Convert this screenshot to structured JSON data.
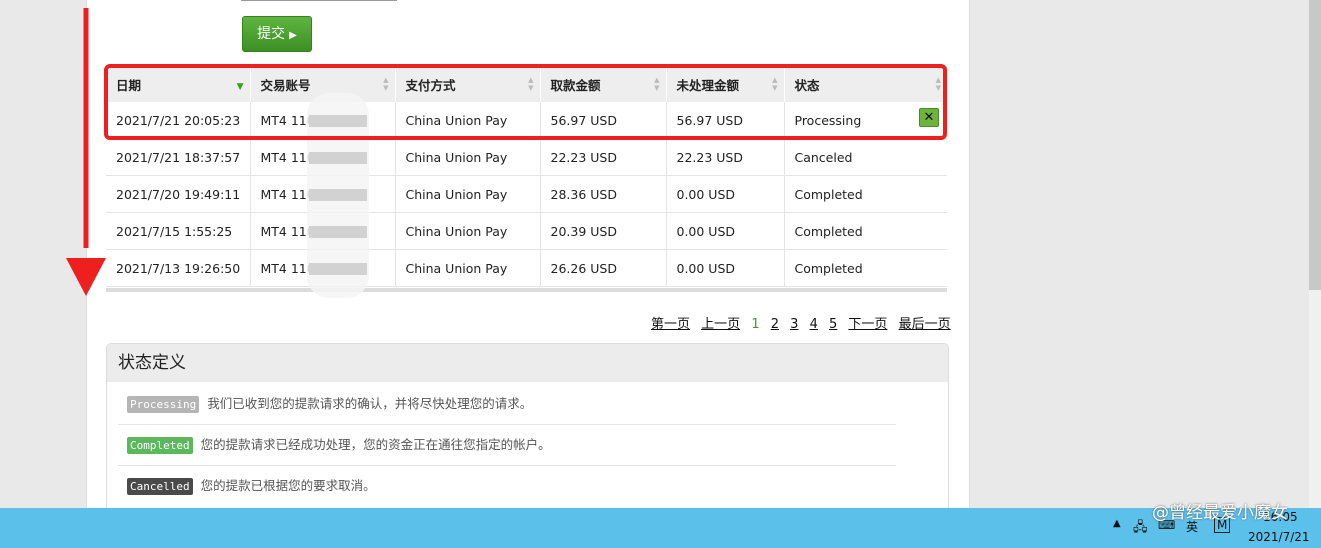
{
  "form": {
    "submit_label": "提交"
  },
  "table": {
    "headers": [
      "日期",
      "交易账号",
      "支付方式",
      "取款金额",
      "未处理金额",
      "状态"
    ],
    "rows": [
      {
        "date": "2021/7/21 20:05:23",
        "account": "MT4 110",
        "method": "China Union Pay",
        "amount": "56.97 USD",
        "pending": "56.97 USD",
        "status": "Processing"
      },
      {
        "date": "2021/7/21 18:37:57",
        "account": "MT4 110",
        "method": "China Union Pay",
        "amount": "22.23 USD",
        "pending": "22.23 USD",
        "status": "Canceled"
      },
      {
        "date": "2021/7/20 19:49:11",
        "account": "MT4 110",
        "method": "China Union Pay",
        "amount": "28.36 USD",
        "pending": "0.00 USD",
        "status": "Completed"
      },
      {
        "date": "2021/7/15 1:55:25",
        "account": "MT4 110",
        "method": "China Union Pay",
        "amount": "20.39 USD",
        "pending": "0.00 USD",
        "status": "Completed"
      },
      {
        "date": "2021/7/13 19:26:50",
        "account": "MT4 110",
        "method": "China Union Pay",
        "amount": "26.26 USD",
        "pending": "0.00 USD",
        "status": "Completed"
      }
    ]
  },
  "pagination": {
    "first": "第一页",
    "prev": "上一页",
    "pages": [
      "1",
      "2",
      "3",
      "4",
      "5"
    ],
    "next": "下一页",
    "last": "最后一页"
  },
  "status_defs": {
    "title": "状态定义",
    "items": [
      {
        "badge": "Processing",
        "color": "#b5b5b5",
        "text": "我们已收到您的提款请求的确认，并将尽快处理您的请求。"
      },
      {
        "badge": "Completed",
        "color": "#5cb85c",
        "text": "您的提款请求已经成功处理，您的资金正在通往您指定的帐户。"
      },
      {
        "badge": "Cancelled",
        "color": "#4a4a4a",
        "text": "您的提款已根据您的要求取消。"
      }
    ]
  },
  "taskbar": {
    "ime_label": "英",
    "ime_mode": "M",
    "date": "2021/7/21",
    "time": "16:05"
  },
  "watermark": "@曾经最爱小魔女",
  "colors": {
    "highlight": "#ee1f1f",
    "accent_green": "#3d9a2a",
    "taskbar": "#5bc1eb"
  }
}
